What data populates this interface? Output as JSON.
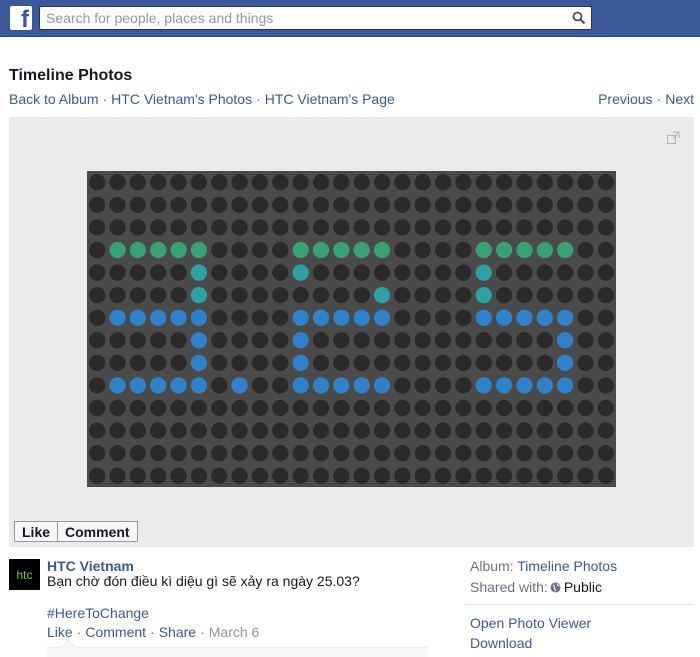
{
  "header": {
    "logo_letter": "f",
    "search_placeholder": "Search for people, places and things"
  },
  "title": "Timeline Photos",
  "breadcrumbs": [
    {
      "label": "Back to Album"
    },
    {
      "label": "HTC Vietnam's Photos"
    },
    {
      "label": "HTC Vietnam's Page"
    }
  ],
  "breadcrumb_separator": "·",
  "nav": {
    "previous": "Previous",
    "next": "Next"
  },
  "photo": {
    "description": "LED dot-matrix board showing pattern",
    "colors": {
      "background": "#4a4a4a",
      "off": "#2a2a2a",
      "green": "#3aa173",
      "teal": "#2fa0a6",
      "blue": "#2f82c9"
    },
    "pattern": [
      "..........................",
      "..........................",
      "..........................",
      ".GGGGG....GGGGG....GGGGG..",
      ".....T....T........T......",
      ".....T........T....T......",
      ".BBBBB....BBBBB....BBBBB..",
      ".....B....B............B..",
      ".....B....B............B..",
      ".BBBBB.B..BBBBB....BBBBB..",
      "..........................",
      "..........................",
      "..........................",
      ".........................."
    ]
  },
  "actions": {
    "like": "Like",
    "comment": "Comment"
  },
  "post": {
    "avatar_text": "htc",
    "author": "HTC Vietnam",
    "caption": "Bạn chờ đón điều kì diệu gì sẽ xảy ra ngày 25.03?",
    "hashtag": "#HereToChange",
    "meta": {
      "like": "Like",
      "comment": "Comment",
      "share": "Share",
      "date": "March 6"
    }
  },
  "sidebar": {
    "album_label": "Album:",
    "album_value": "Timeline Photos",
    "shared_label": "Shared with:",
    "shared_value": "Public",
    "open_viewer": "Open Photo Viewer",
    "download": "Download"
  }
}
